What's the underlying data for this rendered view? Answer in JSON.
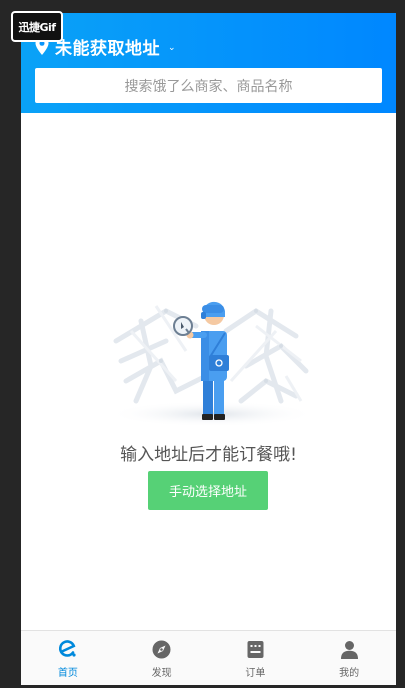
{
  "header": {
    "location_text": "未能获取地址",
    "location_caret": "⌄",
    "search_placeholder": "搜索饿了么商家、商品名称"
  },
  "main": {
    "message": "输入地址后才能订餐哦!",
    "manual_button_label": "手动选择地址"
  },
  "tabbar": {
    "items": [
      {
        "label": "首页",
        "icon": "eleme-logo-icon",
        "active": true
      },
      {
        "label": "发现",
        "icon": "compass-icon",
        "active": false
      },
      {
        "label": "订单",
        "icon": "order-icon",
        "active": false
      },
      {
        "label": "我的",
        "icon": "user-icon",
        "active": false
      }
    ]
  },
  "colors": {
    "header_blue": "#0087ff",
    "button_green": "#56d176",
    "active_tab": "#0089dc"
  },
  "watermark": "迅捷Gif"
}
